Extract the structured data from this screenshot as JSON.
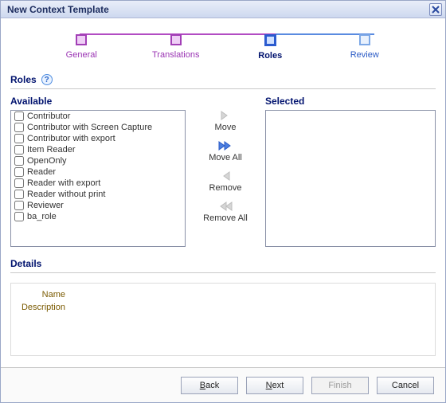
{
  "title": "New Context Template",
  "steps": {
    "general": "General",
    "translations": "Translations",
    "roles": "Roles",
    "review": "Review"
  },
  "section_label": "Roles",
  "available_label": "Available",
  "selected_label": "Selected",
  "roles_list": [
    "Contributor",
    "Contributor with Screen Capture",
    "Contributor with export",
    "Item Reader",
    "OpenOnly",
    "Reader",
    "Reader with export",
    "Reader without print",
    "Reviewer",
    "ba_role"
  ],
  "middle": {
    "move": "Move",
    "move_all": "Move All",
    "remove": "Remove",
    "remove_all": "Remove All"
  },
  "details": {
    "header": "Details",
    "name_label": "Name",
    "desc_label": "Description"
  },
  "buttons": {
    "back": "Back",
    "next": "Next",
    "finish": "Finish",
    "cancel": "Cancel"
  }
}
